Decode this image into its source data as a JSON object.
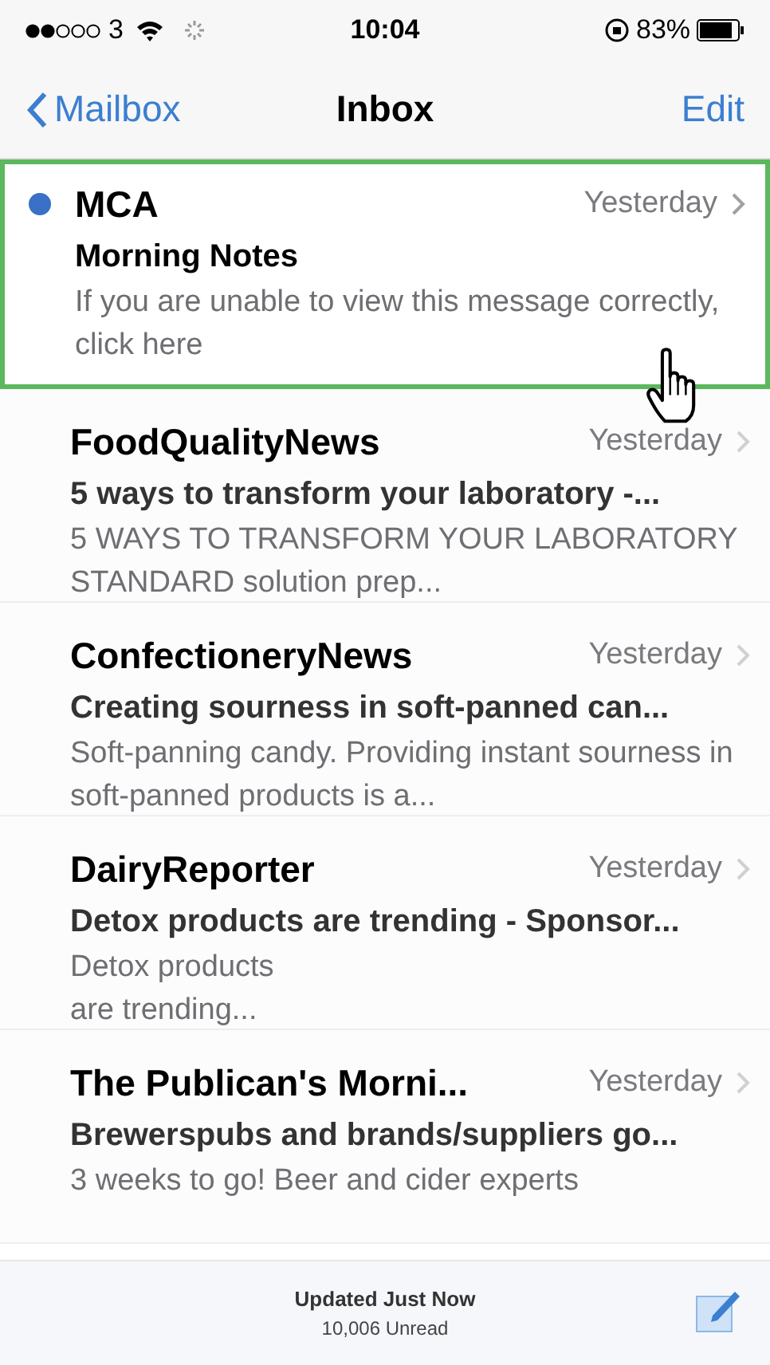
{
  "status_bar": {
    "carrier": "3",
    "time": "10:04",
    "battery": "83%"
  },
  "nav": {
    "back": "Mailbox",
    "title": "Inbox",
    "action": "Edit"
  },
  "messages": [
    {
      "sender": "MCA",
      "date": "Yesterday",
      "subject": "Morning Notes",
      "preview": "If you are unable to view this message correctly, click here",
      "unread": true,
      "highlighted": true,
      "blurred": false
    },
    {
      "sender": "FoodQualityNews",
      "date": "Yesterday",
      "subject": "5 ways to transform your laboratory -...",
      "preview": "5 WAYS TO TRANSFORM YOUR LABORATORY STANDARD solution prep...",
      "unread": false,
      "highlighted": false,
      "blurred": true
    },
    {
      "sender": "ConfectioneryNews",
      "date": "Yesterday",
      "subject": "Creating sourness in soft-panned can...",
      "preview": "Soft-panning candy. Providing instant sourness in soft-panned products is a...",
      "unread": false,
      "highlighted": false,
      "blurred": true
    },
    {
      "sender": "DairyReporter",
      "date": "Yesterday",
      "subject": "Detox products are trending - Sponsor...",
      "preview": "Detox products\nare trending...",
      "unread": false,
      "highlighted": false,
      "blurred": true
    },
    {
      "sender": "The Publican's Morni...",
      "date": "Yesterday",
      "subject": "Brewerspubs and brands/suppliers go...",
      "preview": "3 weeks to go! Beer and cider experts",
      "unread": false,
      "highlighted": false,
      "blurred": true
    }
  ],
  "toolbar": {
    "status": "Updated Just Now",
    "count": "10,006 Unread"
  }
}
